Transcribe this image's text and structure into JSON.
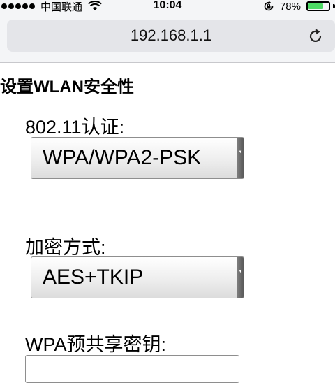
{
  "status_bar": {
    "carrier": "中国联通",
    "time": "10:04",
    "battery_percent": "78%",
    "battery_level": 0.78,
    "signal_bars": 5,
    "battery_color": "#4cd964"
  },
  "browser": {
    "address": "192.168.1.1",
    "reload_icon": "reload-icon"
  },
  "page": {
    "section_title": "设置WLAN安全性",
    "auth_label": "802.11认证:",
    "auth_value": "WPA/WPA2-PSK",
    "encryption_label": "加密方式:",
    "encryption_value": "AES+TKIP",
    "psk_label": "WPA预共享密钥:",
    "psk_value": ""
  }
}
